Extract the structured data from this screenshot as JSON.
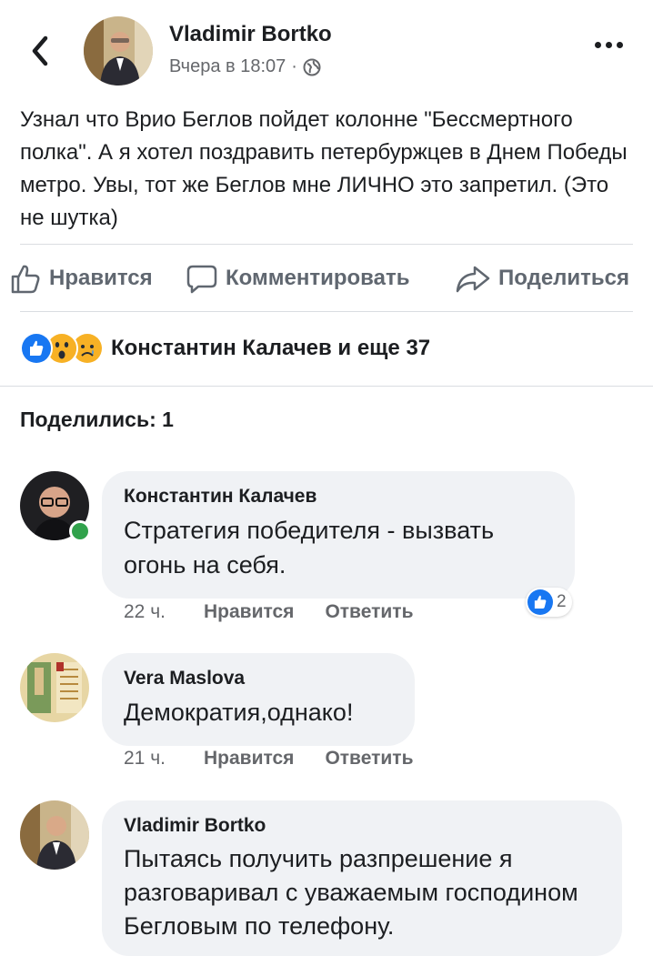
{
  "header": {
    "author": "Vladimir Bortko",
    "time": "Вчера в 18:07",
    "separator": "·",
    "icons": {
      "back": "chevron-left-icon",
      "privacy": "globe-icon",
      "more": "more-horizontal-icon"
    }
  },
  "post": {
    "text": "Узнал что Врио Беглов пойдет колонне \"Бессмертного полка\". А я хотел поздравить петербуржцев в Днем Победы метро. Увы, тот же Беглов мне ЛИЧНО это запретил. (Это не шутка)"
  },
  "actions": {
    "like": "Нравится",
    "comment": "Комментировать",
    "share": "Поделиться"
  },
  "reactions": {
    "summary": "Константин Калачев и еще 37",
    "types": [
      "like",
      "wow",
      "sad"
    ],
    "colors": {
      "like": "#1877f2",
      "face": "#f7b125"
    }
  },
  "shares_label": "Поделились: 1",
  "comments": [
    {
      "author": "Константин Калачев",
      "text": "Стратегия победителя - вызвать огонь на себя.",
      "time": "22 ч.",
      "like": "Нравится",
      "reply": "Ответить",
      "reaction_count": "2",
      "online": true
    },
    {
      "author": "Vera Maslova",
      "text": "Демократия,однако!",
      "time": "21 ч.",
      "like": "Нравится",
      "reply": "Ответить"
    },
    {
      "author": "Vladimir Bortko",
      "text": "Пытаясь получить разпрешение я разговаривал с уважаемым господином Бегловым по телефону."
    }
  ]
}
